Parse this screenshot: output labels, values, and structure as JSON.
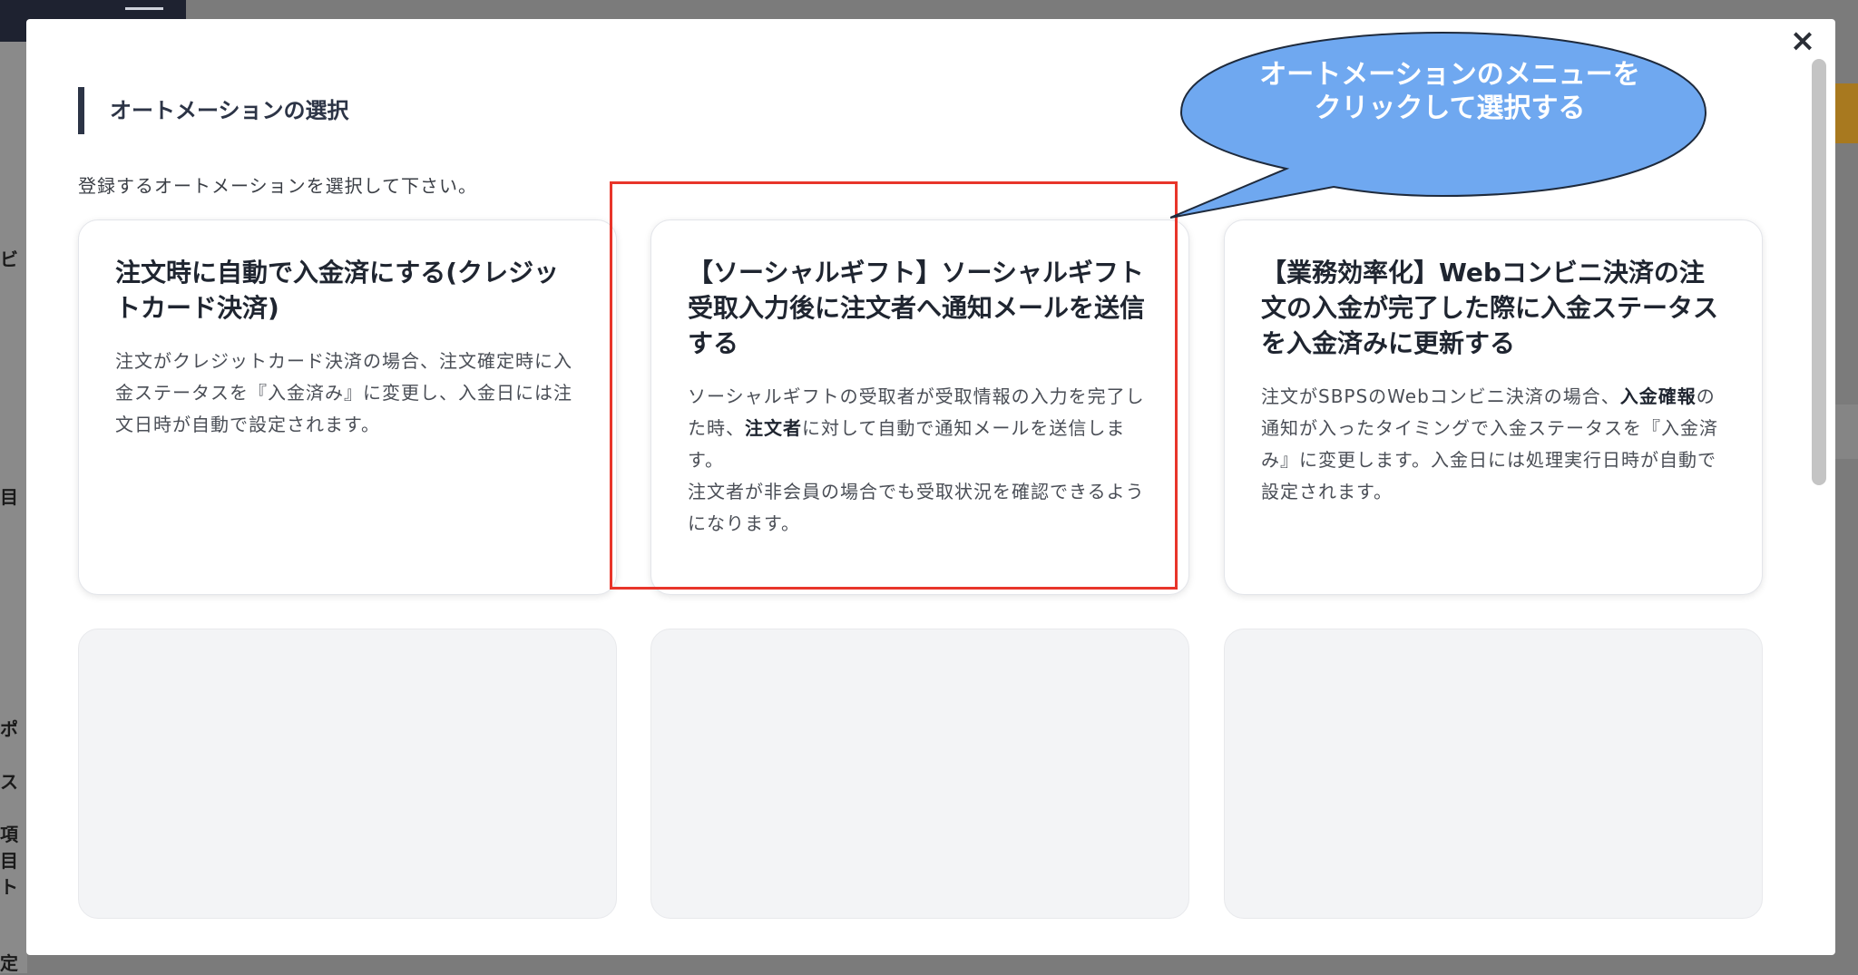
{
  "modal": {
    "close_label": "×",
    "title": "オートメーションの選択",
    "description": "登録するオートメーションを選択して下さい。"
  },
  "cards": [
    {
      "title": "注文時に自動で入金済にする(クレジットカード決済)",
      "body": "注文がクレジットカード決済の場合、注文確定時に入金ステータスを『入金済み』に変更し、入金日には注文日時が自動で設定されます。"
    },
    {
      "title": "【ソーシャルギフト】ソーシャルギフト受取入力後に注文者へ通知メールを送信する",
      "body_1": "ソーシャルギフトの受取者が受取情報の入力を完了した時、",
      "body_bold": "注文者",
      "body_2": "に対して自動で通知メールを送信します。",
      "body_3": "注文者が非会員の場合でも受取状況を確認できるようになります。"
    },
    {
      "title": "【業務効率化】Webコンビニ決済の注文の入金が完了した際に入金ステータスを入金済みに更新する",
      "body_1": "注文がSBPSのWebコンビニ決済の場合、",
      "body_bold": "入金確報",
      "body_2": "の通知が入ったタイミングで入金ステータスを『入金済み』に変更します。入金日には処理実行日時が自動で設定されます。"
    }
  ],
  "callout": {
    "line1": "オートメーションのメニューを",
    "line2": "クリックして選択する",
    "color": "#6fa8f0"
  },
  "highlight_color": "#e8352a",
  "background_fragments": [
    "ビ",
    "目",
    "ポ",
    "ス",
    "項目",
    "ト",
    "定"
  ]
}
